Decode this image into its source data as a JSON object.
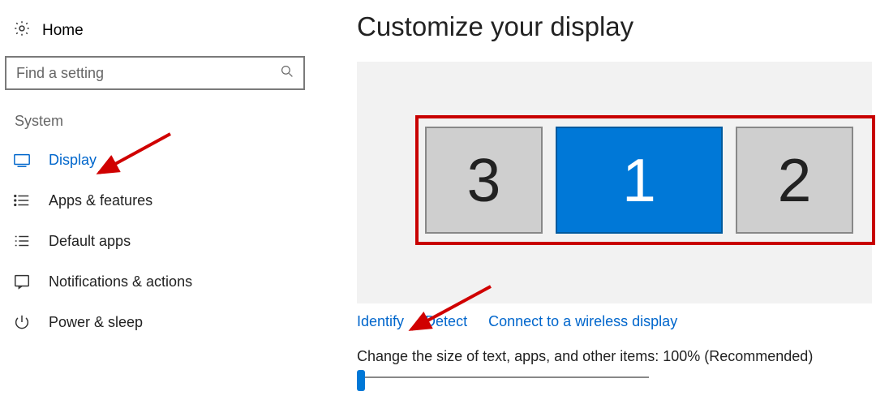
{
  "sidebar": {
    "home": "Home",
    "searchPlaceholder": "Find a setting",
    "sectionHeader": "System",
    "items": [
      {
        "label": "Display"
      },
      {
        "label": "Apps & features"
      },
      {
        "label": "Default apps"
      },
      {
        "label": "Notifications & actions"
      },
      {
        "label": "Power & sleep"
      }
    ]
  },
  "main": {
    "title": "Customize your display",
    "monitors": [
      {
        "id": "3"
      },
      {
        "id": "1"
      },
      {
        "id": "2"
      }
    ],
    "links": {
      "identify": "Identify",
      "detect": "Detect",
      "connect": "Connect to a wireless display"
    },
    "scaleLabel": "Change the size of text, apps, and other items: 100% (Recommended)"
  }
}
